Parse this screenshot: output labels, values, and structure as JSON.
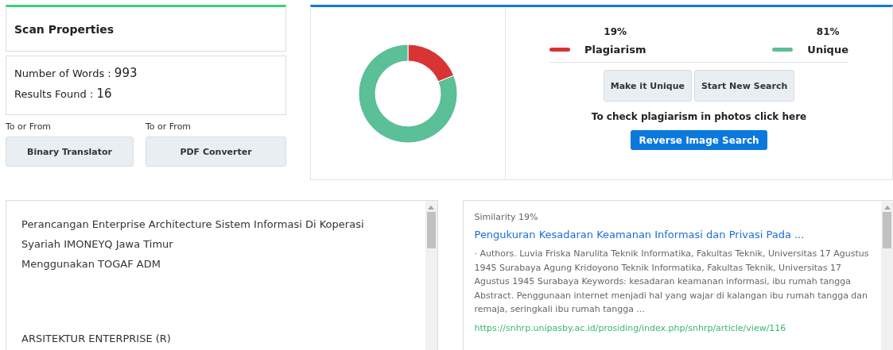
{
  "scan_properties": {
    "title": "Scan Properties",
    "stats": [
      {
        "label": "Number of Words : ",
        "value": "993"
      },
      {
        "label": "Results Found : ",
        "value": "16"
      }
    ]
  },
  "tools": [
    {
      "caption": "To or From",
      "button": "Binary Translator"
    },
    {
      "caption": "To or From",
      "button": "PDF Converter"
    }
  ],
  "result": {
    "chart_data": {
      "type": "donut",
      "categories": [
        "Plagiarism",
        "Unique"
      ],
      "values": [
        19,
        81
      ]
    },
    "legend": [
      {
        "percent": "19%",
        "color": "#d83434"
      },
      {
        "percent": "81%",
        "color": "#5bbf98"
      }
    ],
    "buttons": [
      "Make it Unique",
      "Start New Search"
    ],
    "photo_hint": "To check plagiarism in photos click here",
    "reverse_button": "Reverse Image Search"
  },
  "document": {
    "lines": [
      "Perancangan Enterprise Architecture Sistem Informasi Di Koperasi",
      "Syariah IMONEYQ Jawa Timur",
      "Menggunakan TOGAF ADM"
    ],
    "heading": "ARSITEKTUR ENTERPRISE (R)"
  },
  "matches": [
    {
      "similarity": "Similarity 19%",
      "title": "Pengukuran Kesadaran Keamanan Informasi dan Privasi Pada ...",
      "snippet": " · Authors. Luvia Friska Narulita Teknik Informatika, Fakultas Teknik, Universitas 17 Agustus 1945 Surabaya Agung Kridoyono Teknik Informatika, Fakultas Teknik, Universitas 17 Agustus 1945 Surabaya Keywords: kesadaran keamanan informasi, ibu rumah tangga Abstract. Penggunaan internet menjadi hal yang wajar di kalangan ibu rumah tangga dan remaja, seringkali ibu rumah tangga ...",
      "url": "https://snhrp.unipasby.ac.id/prosiding/index.php/snhrp/article/view/116"
    }
  ]
}
